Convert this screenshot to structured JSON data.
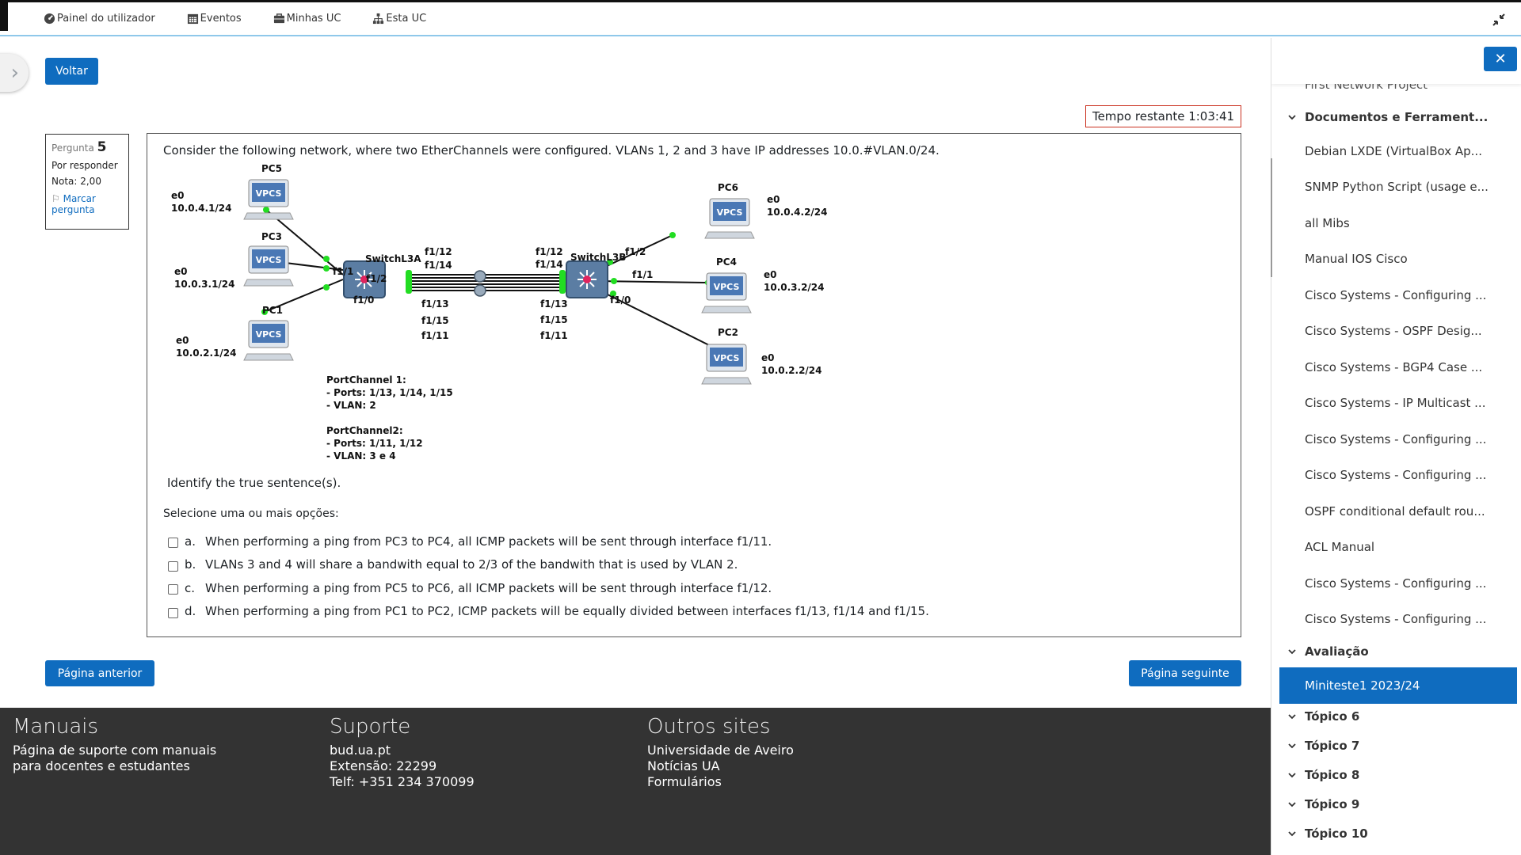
{
  "nav": {
    "items": [
      {
        "label": "Painel do utilizador",
        "icon": "dashboard-icon"
      },
      {
        "label": "Eventos",
        "icon": "calendar-icon"
      },
      {
        "label": "Minhas UC",
        "icon": "briefcase-icon"
      },
      {
        "label": "Esta UC",
        "icon": "sitemap-icon"
      }
    ]
  },
  "back_label": "Voltar",
  "timer": "Tempo restante 1:03:41",
  "question_info": {
    "label": "Pergunta",
    "number": "5",
    "status": "Por responder",
    "grade": "Nota: 2,00",
    "flag": "Marcar pergunta"
  },
  "question": {
    "text": "Consider the following network, where two EtherChannels were configured. VLANs 1, 2 and 3 have IP addresses 10.0.#VLAN.0/24.",
    "identify": "Identify the true sentence(s).",
    "prompt": "Selecione uma ou mais opções:",
    "options": [
      {
        "letter": "a.",
        "text": "When performing a ping from PC3 to PC4, all ICMP packets will be sent through interface f1/11."
      },
      {
        "letter": "b.",
        "text": "VLANs 3 and 4 will share a bandwith equal to 2/3 of the bandwith that is used by VLAN 2."
      },
      {
        "letter": "c.",
        "text": "When performing a ping from PC5 to PC6, all ICMP packets will be sent through interface f1/12."
      },
      {
        "letter": "d.",
        "text": "When performing a ping from PC1 to PC2, ICMP packets will be equally divided between interfaces f1/13, f1/14 and f1/15."
      }
    ]
  },
  "diagram": {
    "pcs": {
      "pc5": {
        "name": "PC5",
        "if": "e0",
        "ip": "10.0.4.1/24"
      },
      "pc3": {
        "name": "PC3",
        "if": "e0",
        "ip": "10.0.3.1/24"
      },
      "pc1": {
        "name": "PC1",
        "if": "e0",
        "ip": "10.0.2.1/24"
      },
      "pc6": {
        "name": "PC6",
        "if": "e0",
        "ip": "10.0.4.2/24"
      },
      "pc4": {
        "name": "PC4",
        "if": "e0",
        "ip": "10.0.3.2/24"
      },
      "pc2": {
        "name": "PC2",
        "if": "e0",
        "ip": "10.0.2.2/24"
      }
    },
    "vpcs": "VPCS",
    "switch_a": "SwitchL3A",
    "switch_b": "SwitchL3B",
    "ports": {
      "a_f11": "f1/1",
      "a_f12": "f1/2",
      "a_f10": "f1/0",
      "a_f112": "f1/12",
      "a_f114": "f1/14",
      "a_f113": "f1/13",
      "a_f115": "f1/15",
      "a_f111": "f1/11",
      "b_f112": "f1/12",
      "b_f114": "f1/14",
      "b_f113": "f1/13",
      "b_f115": "f1/15",
      "b_f111": "f1/11",
      "b_f12": "f1/2",
      "b_f11": "f1/1",
      "b_f10": "f1/0"
    },
    "pc1_notes": [
      "PortChannel 1:",
      "- Ports: 1/13, 1/14, 1/15",
      "- VLAN: 2"
    ],
    "pc2_notes": [
      "PortChannel2:",
      "- Ports: 1/11, 1/12",
      "- VLAN: 3 e 4"
    ],
    "colors": {
      "link_up": "#22dd22",
      "switch": "#5b7da3",
      "hub": "#e0245e"
    }
  },
  "buttons": {
    "prev": "Página anterior",
    "next": "Página seguinte"
  },
  "footer": {
    "manuais": {
      "title": "Manuais",
      "lines": [
        "Página de suporte com manuais",
        "para docentes e estudantes"
      ]
    },
    "suporte": {
      "title": "Suporte",
      "lines": [
        "bud.ua.pt",
        "Extensão: 22299",
        "Telf: +351 234 370099"
      ]
    },
    "outros": {
      "title": "Outros sites",
      "lines": [
        "Universidade de Aveiro",
        "Notícias UA",
        "Formulários"
      ]
    }
  },
  "sidebar": {
    "top_partial": "First Network Project",
    "section_docs": "Documentos e Ferrament...",
    "items": [
      "Debian LXDE (VirtualBox Ap...",
      "SNMP Python Script (usage e...",
      "all Mibs",
      "Manual IOS Cisco",
      "Cisco Systems - Configuring ...",
      "Cisco Systems - OSPF Desig...",
      "Cisco Systems - BGP4 Case ...",
      "Cisco Systems - IP Multicast ...",
      "Cisco Systems - Configuring ...",
      "Cisco Systems - Configuring ...",
      "OSPF conditional default rou...",
      "ACL Manual",
      "Cisco Systems - Configuring ...",
      "Cisco Systems - Configuring ..."
    ],
    "section_aval": "Avaliação",
    "active": "Miniteste1 2023/24",
    "topics": [
      "Tópico 6",
      "Tópico 7",
      "Tópico 8",
      "Tópico 9",
      "Tópico 10"
    ]
  }
}
